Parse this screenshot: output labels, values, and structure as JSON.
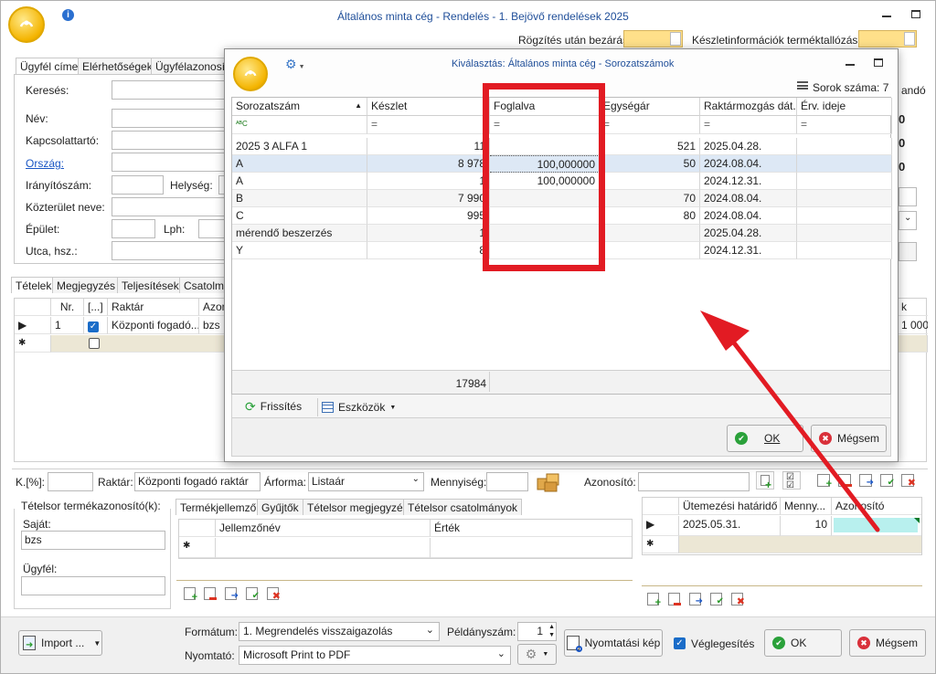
{
  "app": {
    "title": "Általános minta cég - Rendelés - 1. Bejövő rendelések 2025",
    "close_after_save_label": "Rögzítés után bezárás",
    "stock_info_label": "Készletinformációk terméktallózáskor"
  },
  "customer_tabs": [
    "Ügyfél címe",
    "Elérhetőségek",
    "Ügyfélazonosító"
  ],
  "customer_form": {
    "search": "Keresés:",
    "name": "Név:",
    "contact": "Kapcsolattartó:",
    "country": "Ország:",
    "zip": "Irányítószám:",
    "city": "Helység:",
    "street_name": "Közterület neve:",
    "building": "Épület:",
    "stairway": "Lph:",
    "street_no": "Utca, hsz.:"
  },
  "right_partial": {
    "ando": "andó",
    "a": "a",
    "k": "k",
    "v1000": "1 000"
  },
  "items_tabs": [
    "Tételek",
    "Megjegyzés",
    "Teljesítések",
    "Csatolmányok"
  ],
  "items_grid": {
    "headers": [
      "Nr.",
      "[...]",
      "Raktár",
      "Azon"
    ],
    "rows": [
      {
        "nr": "1",
        "checked": true,
        "warehouse": "Központi fogadó...",
        "id": "bzs"
      }
    ]
  },
  "filter_bar": {
    "discount": "K.[%]:",
    "warehouse_label": "Raktár:",
    "warehouse_value": "Központi fogadó raktár",
    "price_type_label": "Árforma:",
    "price_type_value": "Listaár",
    "quantity_label": "Mennyiség:",
    "identifier_label": "Azonosító:"
  },
  "product_id_panel": {
    "title": "Tételsor termékazonosító(k):",
    "own_label": "Saját:",
    "own_value": "bzs",
    "customer_label": "Ügyfél:"
  },
  "feature_tabs": [
    "Termékjellemzők",
    "Gyűjtők",
    "Tételsor megjegyzés",
    "Tételsor csatolmányok"
  ],
  "feature_grid": {
    "headers": [
      "Jellemzőnév",
      "Érték"
    ]
  },
  "schedule_grid": {
    "headers": [
      "Ütemezési határidő",
      "Menny...",
      "Azonosító"
    ],
    "rows": [
      {
        "date": "2025.05.31.",
        "qty": "10",
        "id": ""
      }
    ]
  },
  "bottom": {
    "import_label": "Import ...",
    "format_label": "Formátum:",
    "format_value": "1. Megrendelés visszaigazolás",
    "copies_label": "Példányszám:",
    "copies_value": "1",
    "printer_label": "Nyomtató:",
    "printer_value": "Microsoft Print to PDF",
    "preview_label": "Nyomtatási kép",
    "finalize_label": "Véglegesítés",
    "ok_label": "OK",
    "cancel_label": "Mégsem"
  },
  "modal": {
    "title": "Kiválasztás: Általános minta cég - Sorozatszámok",
    "row_count": "Sorok száma: 7",
    "headers": [
      "Sorozatszám",
      "Készlet",
      "Foglalva",
      "Egységár",
      "Raktármozgás dát...",
      "Érv. ideje"
    ],
    "filter_symbol": "=",
    "rows": [
      {
        "serial": "2025 3 ALFA 1",
        "stock": "11",
        "reserved": "",
        "price": "521",
        "date": "2025.04.28.",
        "expiry": ""
      },
      {
        "serial": "A",
        "stock": "8 978",
        "reserved": "100,000000",
        "price": "50",
        "date": "2024.08.04.",
        "expiry": ""
      },
      {
        "serial": "A",
        "stock": "1",
        "reserved": "100,000000",
        "price": "",
        "date": "2024.12.31.",
        "expiry": ""
      },
      {
        "serial": "B",
        "stock": "7 990",
        "reserved": "",
        "price": "70",
        "date": "2024.08.04.",
        "expiry": ""
      },
      {
        "serial": "C",
        "stock": "995",
        "reserved": "",
        "price": "80",
        "date": "2024.08.04.",
        "expiry": ""
      },
      {
        "serial": "mérendő beszerzés",
        "stock": "1",
        "reserved": "",
        "price": "",
        "date": "2025.04.28.",
        "expiry": ""
      },
      {
        "serial": "Y",
        "stock": "8",
        "reserved": "",
        "price": "",
        "date": "2024.12.31.",
        "expiry": ""
      }
    ],
    "total": "17984",
    "refresh_label": "Frissítés",
    "tools_label": "Eszközök",
    "ok_label": "OK",
    "cancel_label": "Mégsem"
  },
  "colors": {
    "accent": "#1f4e99",
    "highlight": "#e21b23",
    "row_selected": "#dde8f5"
  }
}
